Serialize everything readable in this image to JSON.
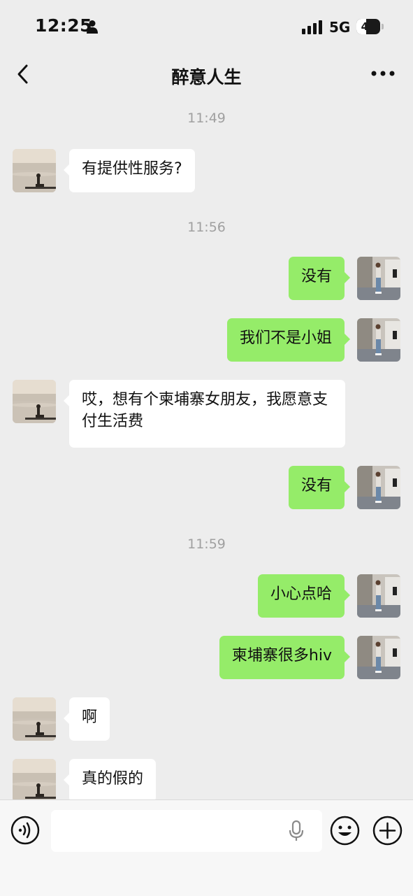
{
  "status_bar": {
    "time": "12:25",
    "network": "5G",
    "battery": "41",
    "battery_level": 0.41
  },
  "header": {
    "title": "醉意人生",
    "back_icon": "chevron-left-icon",
    "more_icon": "more-dots-icon"
  },
  "messages": [
    {
      "type": "time",
      "text": "11:49"
    },
    {
      "type": "in",
      "text": "有提供性服务?"
    },
    {
      "type": "time",
      "text": "11:56"
    },
    {
      "type": "out",
      "text": "没有"
    },
    {
      "type": "out",
      "text": "我们不是小姐"
    },
    {
      "type": "in",
      "text": "哎，想有个柬埔寨女朋友，我愿意支付生活费"
    },
    {
      "type": "out",
      "text": "没有"
    },
    {
      "type": "time",
      "text": "11:59"
    },
    {
      "type": "out",
      "text": "小心点哈"
    },
    {
      "type": "out",
      "text": "柬埔寨很多hiv"
    },
    {
      "type": "in",
      "text": "啊"
    },
    {
      "type": "in",
      "text": "真的假的"
    }
  ],
  "input_bar": {
    "placeholder": "",
    "icons": [
      "voice-icon",
      "microphone-icon",
      "emoji-icon",
      "plus-icon"
    ]
  },
  "colors": {
    "background": "#ededed",
    "outgoing_bubble": "#95ec69",
    "incoming_bubble": "#ffffff",
    "timestamp": "#a0a0a0"
  }
}
